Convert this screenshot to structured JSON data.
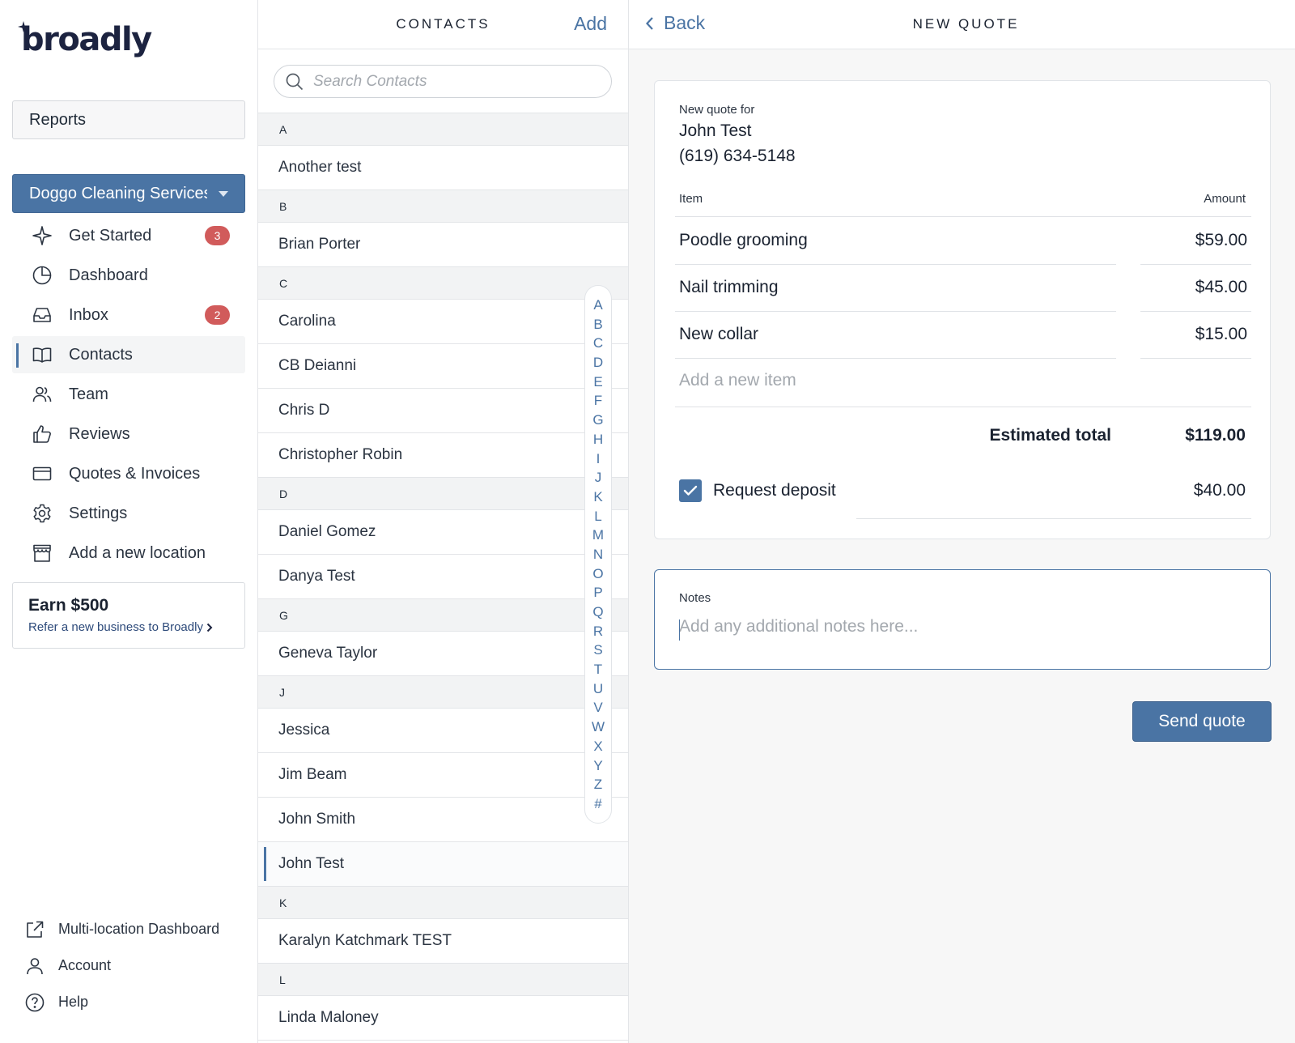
{
  "brand": {
    "logo_text": "broadly"
  },
  "sidebar": {
    "reports_label": "Reports",
    "location": "Doggo Cleaning Services",
    "nav": [
      {
        "label": "Get Started",
        "icon": "sparkle-icon",
        "badge": "3"
      },
      {
        "label": "Dashboard",
        "icon": "pie-chart-icon"
      },
      {
        "label": "Inbox",
        "icon": "inbox-icon",
        "badge": "2"
      },
      {
        "label": "Contacts",
        "icon": "book-icon",
        "active": true
      },
      {
        "label": "Team",
        "icon": "team-icon"
      },
      {
        "label": "Reviews",
        "icon": "thumbs-up-icon"
      },
      {
        "label": "Quotes & Invoices",
        "icon": "card-icon"
      },
      {
        "label": "Settings",
        "icon": "gear-icon"
      },
      {
        "label": "Add a new location",
        "icon": "storefront-icon"
      }
    ],
    "earn": {
      "title": "Earn $500",
      "link": "Refer a new business to Broadly"
    },
    "footer": [
      {
        "label": "Multi-location Dashboard",
        "icon": "external-link-icon"
      },
      {
        "label": "Account",
        "icon": "user-icon"
      },
      {
        "label": "Help",
        "icon": "help-icon"
      }
    ]
  },
  "contacts": {
    "title": "CONTACTS",
    "add_label": "Add",
    "search_placeholder": "Search Contacts",
    "groups": [
      {
        "letter": "A",
        "names": [
          "Another test"
        ]
      },
      {
        "letter": "B",
        "names": [
          "Brian Porter"
        ]
      },
      {
        "letter": "C",
        "names": [
          "Carolina",
          "CB Deianni",
          "Chris D",
          "Christopher Robin"
        ]
      },
      {
        "letter": "D",
        "names": [
          "Daniel Gomez",
          "Danya Test"
        ]
      },
      {
        "letter": "G",
        "names": [
          "Geneva Taylor"
        ]
      },
      {
        "letter": "J",
        "names": [
          "Jessica",
          "Jim Beam",
          "John Smith",
          "John Test"
        ]
      },
      {
        "letter": "K",
        "names": [
          "Karalyn Katchmark TEST"
        ]
      },
      {
        "letter": "L",
        "names": [
          "Linda Maloney"
        ]
      }
    ],
    "selected": "John Test",
    "alphabet": [
      "A",
      "B",
      "C",
      "D",
      "E",
      "F",
      "G",
      "H",
      "I",
      "J",
      "K",
      "L",
      "M",
      "N",
      "O",
      "P",
      "Q",
      "R",
      "S",
      "T",
      "U",
      "V",
      "W",
      "X",
      "Y",
      "Z",
      "#"
    ]
  },
  "quote": {
    "back_label": "Back",
    "title": "NEW QUOTE",
    "for_label": "New quote for",
    "customer_name": "John Test",
    "customer_phone": "(619) 634-5148",
    "col_item": "Item",
    "col_amount": "Amount",
    "items": [
      {
        "name": "Poodle grooming",
        "amount": "$59.00"
      },
      {
        "name": "Nail trimming",
        "amount": "$45.00"
      },
      {
        "name": "New collar",
        "amount": "$15.00"
      }
    ],
    "new_item_placeholder": "Add a new item",
    "total_label": "Estimated total",
    "total_value": "$119.00",
    "deposit_label": "Request deposit",
    "deposit_checked": true,
    "deposit_amount": "$40.00",
    "notes_label": "Notes",
    "notes_placeholder": "Add any additional notes here...",
    "send_label": "Send quote"
  },
  "colors": {
    "accent": "#4a74a4",
    "badge": "#d15b5b",
    "brand_dark": "#1c2340"
  }
}
